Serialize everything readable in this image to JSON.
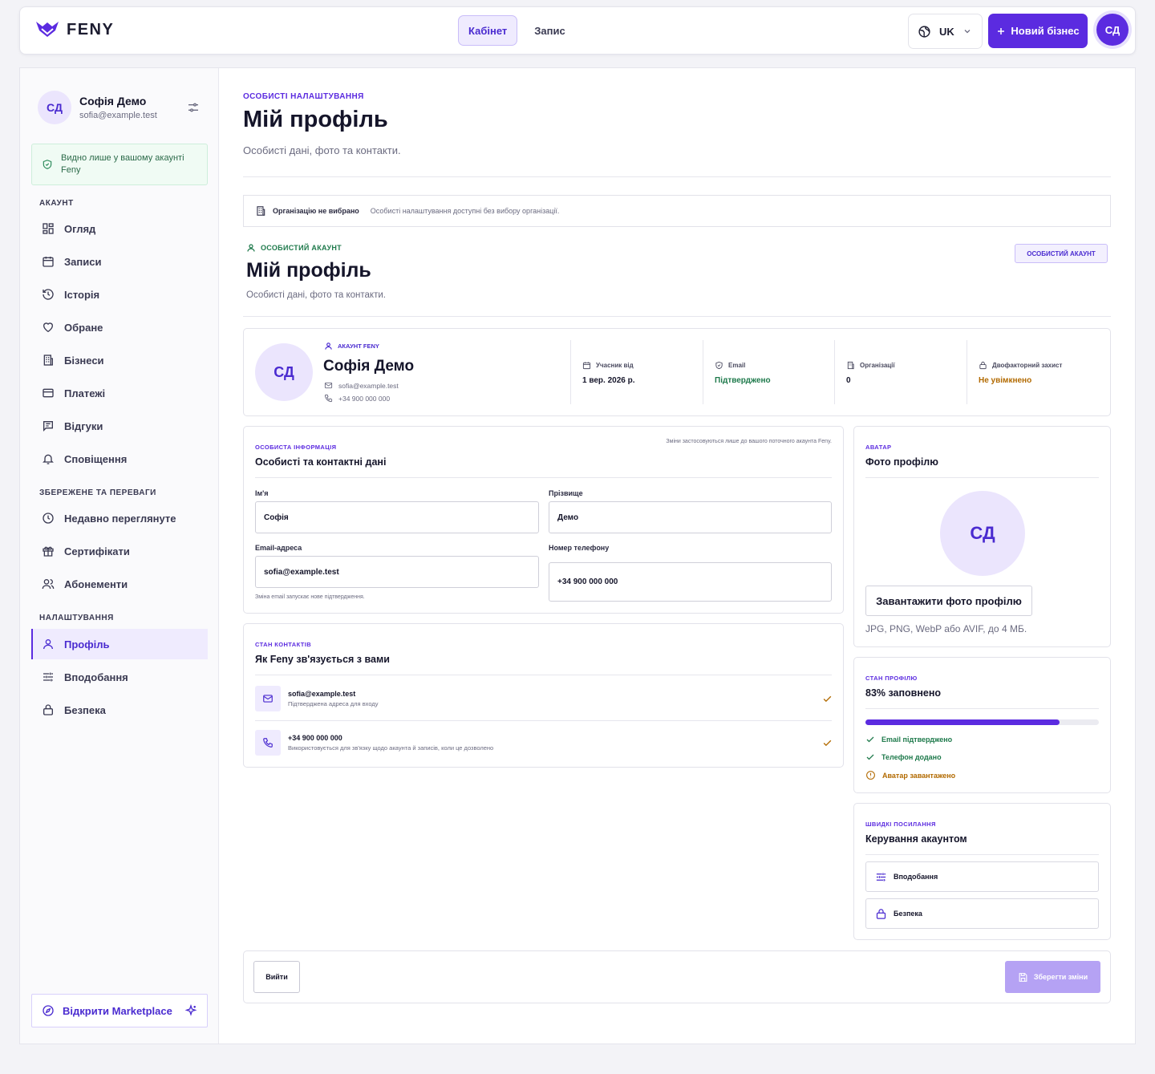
{
  "brand": {
    "name": "FENY",
    "color": "#5b2be0"
  },
  "topbar": {
    "tabs": [
      {
        "label": "Кабінет",
        "active": true
      },
      {
        "label": "Запис",
        "active": false
      }
    ],
    "language": "UK",
    "new_business": "Новий бізнес",
    "avatar": "СД"
  },
  "sidebar": {
    "user": {
      "initials": "СД",
      "name": "Софія Демо",
      "email": "sofia@example.test"
    },
    "privacy_note": "Видно лише у вашому акаунті Feny",
    "sections": [
      {
        "title": "АКАУНТ",
        "items": [
          {
            "label": "Огляд",
            "icon": "grid-icon"
          },
          {
            "label": "Записи",
            "icon": "calendar-icon"
          },
          {
            "label": "Історія",
            "icon": "history-icon"
          },
          {
            "label": "Обране",
            "icon": "heart-icon"
          },
          {
            "label": "Бізнеси",
            "icon": "building-icon"
          },
          {
            "label": "Платежі",
            "icon": "card-icon"
          },
          {
            "label": "Відгуки",
            "icon": "message-icon"
          },
          {
            "label": "Сповіщення",
            "icon": "bell-icon"
          }
        ]
      },
      {
        "title": "ЗБЕРЕЖЕНЕ ТА ПЕРЕВАГИ",
        "items": [
          {
            "label": "Недавно переглянуте",
            "icon": "clock-icon"
          },
          {
            "label": "Сертифікати",
            "icon": "gift-icon"
          },
          {
            "label": "Абонементи",
            "icon": "users-icon"
          }
        ]
      },
      {
        "title": "НАЛАШТУВАННЯ",
        "items": [
          {
            "label": "Профіль",
            "icon": "user-icon",
            "active": true
          },
          {
            "label": "Вподобання",
            "icon": "sliders-icon"
          },
          {
            "label": "Безпека",
            "icon": "lock-icon"
          }
        ]
      }
    ],
    "marketplace": "Відкрити Marketplace"
  },
  "header": {
    "eyebrow": "ОСОБИСТІ НАЛАШТУВАННЯ",
    "title": "Мій профіль",
    "subtitle": "Особисті дані, фото та контакти."
  },
  "org_bar": {
    "title": "Організацію не вибрано",
    "text": "Особисті налаштування доступні без вибору організації."
  },
  "profile_header": {
    "eyebrow": "ОСОБИСТИЙ АКАУНТ",
    "title": "Мій профіль",
    "subtitle": "Особисті дані, фото та контакти.",
    "badge": "ОСОБИСТИЙ АКАУНТ"
  },
  "summary": {
    "initials": "СД",
    "eyebrow": "АКАУНТ FENY",
    "name": "Софія Демо",
    "email": "sofia@example.test",
    "phone": "+34 900 000 000",
    "stats": [
      {
        "label": "Учасник від",
        "value": "1 вер. 2026 р.",
        "color": "#15152a",
        "icon": "calendar-icon"
      },
      {
        "label": "Email",
        "value": "Підтверджено",
        "color": "#1f7a4c",
        "icon": "shield-check-icon"
      },
      {
        "label": "Організації",
        "value": "0",
        "color": "#15152a",
        "icon": "building-icon"
      },
      {
        "label": "Двофакторний захист",
        "value": "Не увімкнено",
        "color": "#b26a00",
        "icon": "lock-icon"
      }
    ]
  },
  "personal": {
    "eyebrow": "ОСОБИСТА ІНФОРМАЦІЯ",
    "title": "Особисті та контактні дані",
    "note": "Зміни застосовуються лише до вашого поточного акаунта Feny.",
    "first_name_label": "Ім'я",
    "first_name": "Софія",
    "last_name_label": "Прізвище",
    "last_name": "Демо",
    "email_label": "Email-адреса",
    "email": "sofia@example.test",
    "email_hint": "Зміна email запускає нове підтвердження.",
    "phone_label": "Номер телефону",
    "phone": "+34 900 000 000"
  },
  "contacts": {
    "eyebrow": "СТАН КОНТАКТІВ",
    "title": "Як Feny зв'язується з вами",
    "rows": [
      {
        "title": "sofia@example.test",
        "desc": "Підтверджена адреса для входу",
        "icon": "mail-icon"
      },
      {
        "title": "+34 900 000 000",
        "desc": "Використовується для зв'язку щодо акаунта й записів, коли це дозволено",
        "icon": "phone-icon"
      }
    ]
  },
  "avatar_card": {
    "eyebrow": "АВАТАР",
    "title": "Фото профілю",
    "initials": "СД",
    "upload": "Завантажити фото профілю",
    "hint": "JPG, PNG, WebP або AVIF, до 4 МБ."
  },
  "profile_status": {
    "eyebrow": "СТАН ПРОФІЛЮ",
    "title": "83% заповнено",
    "progress": 0.83,
    "checks": [
      {
        "label": "Email підтверджено",
        "ok": true
      },
      {
        "label": "Телефон додано",
        "ok": true
      },
      {
        "label": "Аватар завантажено",
        "ok": false
      }
    ]
  },
  "quick_links": {
    "eyebrow": "ШВИДКІ ПОСИЛАННЯ",
    "title": "Керування акаунтом",
    "links": [
      {
        "label": "Вподобання",
        "icon": "sliders-icon"
      },
      {
        "label": "Безпека",
        "icon": "lock-icon"
      }
    ]
  },
  "footer": {
    "logout": "Вийти",
    "save": "Зберегти зміни"
  }
}
